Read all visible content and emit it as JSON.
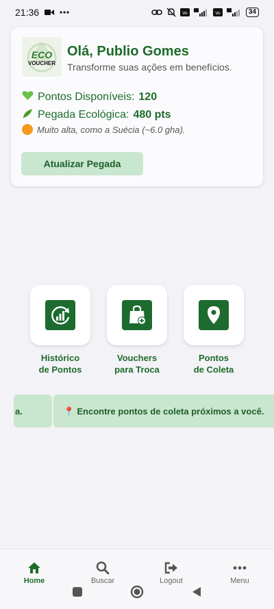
{
  "status_bar": {
    "time": "21:36",
    "battery": "34",
    "icons": [
      "video-icon",
      "more-dots-icon",
      "link-icon",
      "mute-icon",
      "volte-icon",
      "5g-signal-icon",
      "5g-signal-icon",
      "battery-icon"
    ]
  },
  "profile": {
    "logo_text_top": "ECO",
    "logo_text_bottom": "VOUCHER",
    "greeting": "Olá, Publio Gomes",
    "subtitle": "Transforme suas ações em benefícios.",
    "points_label": "Pontos Disponíveis:",
    "points_value": "120",
    "footprint_label": "Pegada Ecológica:",
    "footprint_value": "480 pts",
    "footprint_note": "Muito alta, como a Suécia (~6.0 gha).",
    "update_button": "Atualizar Pegada"
  },
  "actions": [
    {
      "label_line1": "Histórico",
      "label_line2": "de Pontos",
      "icon": "chart-history-icon"
    },
    {
      "label_line1": "Vouchers",
      "label_line2": "para Troca",
      "icon": "shopping-bag-plus-icon"
    },
    {
      "label_line1": "Pontos",
      "label_line2": "de Coleta",
      "icon": "map-pin-icon"
    }
  ],
  "banners": {
    "previous_fragment": "a.",
    "current": "📍 Encontre pontos de coleta próximos a você."
  },
  "bottom_nav": {
    "items": [
      {
        "label": "Home",
        "icon": "home-icon",
        "active": true
      },
      {
        "label": "Buscar",
        "icon": "search-icon",
        "active": false
      },
      {
        "label": "Logout",
        "icon": "logout-icon",
        "active": false
      },
      {
        "label": "Menu",
        "icon": "more-horizontal-icon",
        "active": false
      }
    ]
  },
  "colors": {
    "brand_green": "#1e6b2a",
    "icon_green": "#1d6b2f",
    "light_green": "#c9e6cf",
    "background": "#f3f2f6"
  }
}
